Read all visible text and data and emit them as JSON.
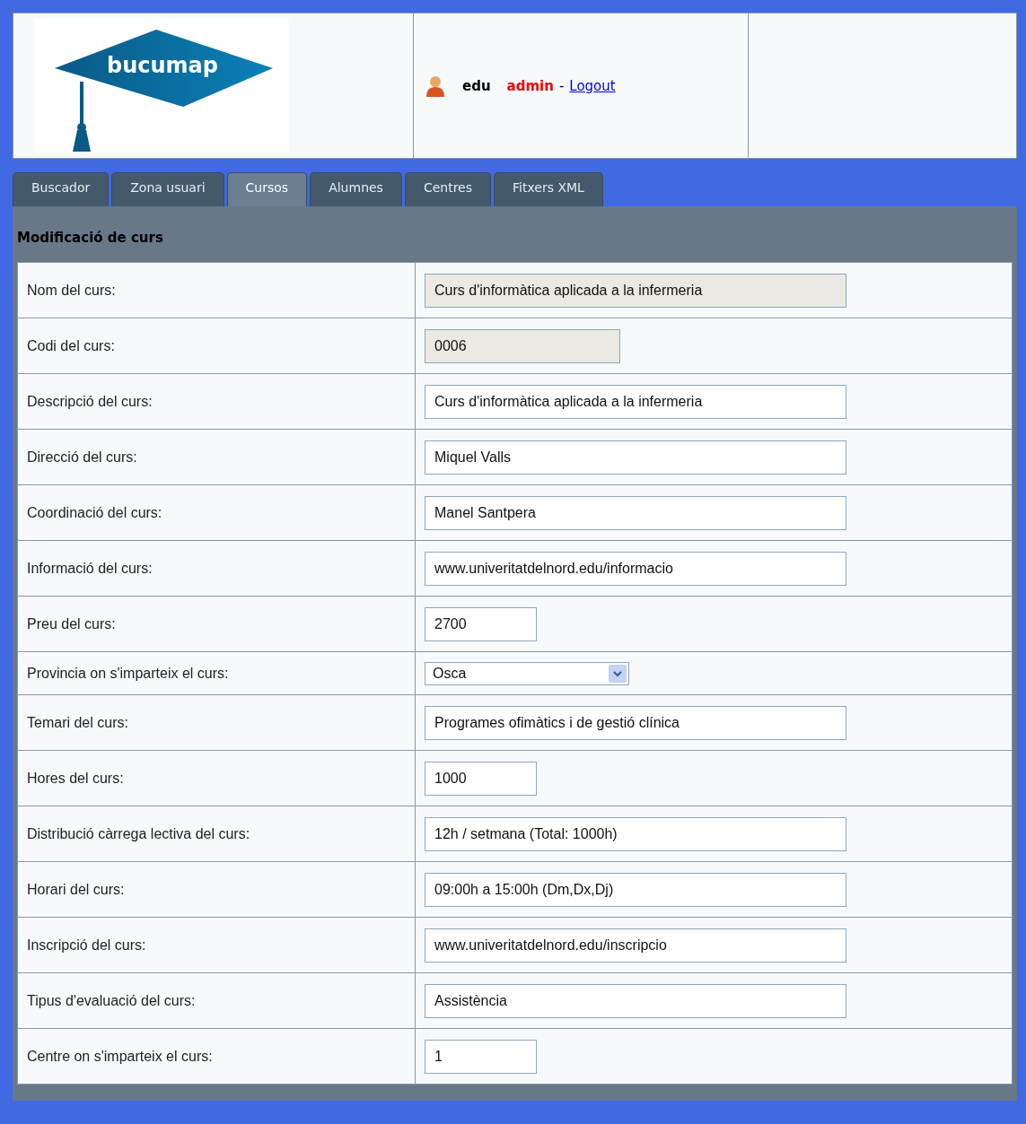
{
  "header": {
    "logo_text": "bucumap",
    "user": "edu",
    "role": "admin",
    "separator": "-",
    "logout": "Logout"
  },
  "tabs": [
    {
      "label": "Buscador",
      "selected": false
    },
    {
      "label": "Zona usuari",
      "selected": false
    },
    {
      "label": "Cursos",
      "selected": true
    },
    {
      "label": "Alumnes",
      "selected": false
    },
    {
      "label": "Centres",
      "selected": false
    },
    {
      "label": "Fitxers XML",
      "selected": false
    }
  ],
  "form": {
    "title": "Modificació de curs",
    "rows": [
      {
        "label": "Nom del curs:",
        "kind": "text",
        "value": "Curs d'informàtica aplicada a la infermeria",
        "disabled": true
      },
      {
        "label": "Codi del curs:",
        "kind": "code",
        "value": "0006",
        "disabled": true
      },
      {
        "label": "Descripció del curs:",
        "kind": "text",
        "value": "Curs d'informàtica aplicada a la infermeria",
        "disabled": false
      },
      {
        "label": "Direcció del curs:",
        "kind": "text",
        "value": "Miquel Valls",
        "disabled": false
      },
      {
        "label": "Coordinació del curs:",
        "kind": "text",
        "value": "Manel Santpera",
        "disabled": false
      },
      {
        "label": "Informació del curs:",
        "kind": "text",
        "value": "www.univeritatdelnord.edu/informacio",
        "disabled": false
      },
      {
        "label": "Preu del curs:",
        "kind": "number",
        "value": "2700",
        "disabled": false
      },
      {
        "label": "Provincia on s'imparteix el curs:",
        "kind": "select",
        "value": "Osca",
        "disabled": false
      },
      {
        "label": "Temari del curs:",
        "kind": "text",
        "value": "Programes ofimàtics i de gestió clínica",
        "disabled": false
      },
      {
        "label": "Hores del curs:",
        "kind": "number",
        "value": "1000",
        "disabled": false
      },
      {
        "label": "Distribució càrrega lectiva del curs:",
        "kind": "text",
        "value": "12h / setmana (Total: 1000h)",
        "disabled": false
      },
      {
        "label": "Horari del curs:",
        "kind": "text",
        "value": "09:00h a 15:00h (Dm,Dx,Dj)",
        "disabled": false
      },
      {
        "label": "Inscripció del curs:",
        "kind": "text",
        "value": "www.univeritatdelnord.edu/inscripcio",
        "disabled": false
      },
      {
        "label": "Tipus d'evaluació del curs:",
        "kind": "text",
        "value": "Assistència",
        "disabled": false
      },
      {
        "label": "Centre on s'imparteix el curs:",
        "kind": "number",
        "value": "1",
        "disabled": false
      }
    ]
  }
}
